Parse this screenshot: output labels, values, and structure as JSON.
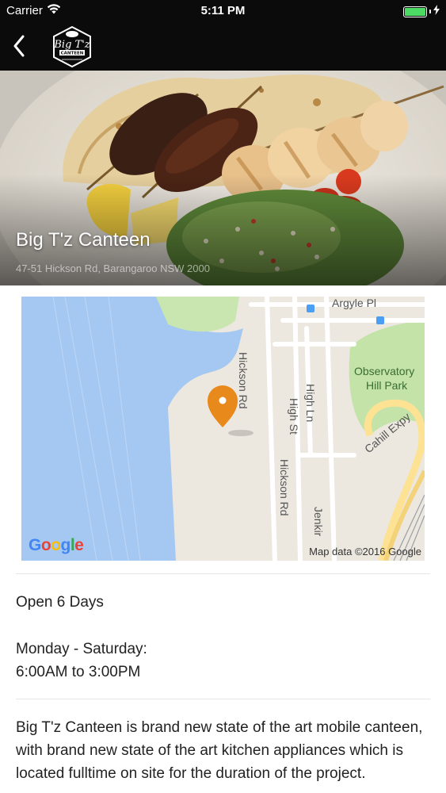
{
  "status_bar": {
    "carrier": "Carrier",
    "time": "5:11 PM",
    "battery_level": 1.0
  },
  "nav": {
    "back_icon": "chevron-left-icon",
    "logo_text": "Big T'z",
    "logo_subtext": "CANTEEN"
  },
  "venue": {
    "name": "Big T'z Canteen",
    "address": "47-51 Hickson Rd, Barangaroo NSW 2000"
  },
  "map": {
    "labels": {
      "argyle": "Argyle Pl",
      "hickson_top": "Hickson Rd",
      "high_ln": "High Ln",
      "high_st": "High St",
      "observatory": "Observatory",
      "hill_park": "Hill Park",
      "cahill": "Cahill Expy",
      "hickson_bottom": "Hickson Rd",
      "jenkins": "Jenkir"
    },
    "google": "Google",
    "credit": "Map data ©2016 Google",
    "pin_color": "#e8891c"
  },
  "details": {
    "open_days": "Open 6 Days",
    "hours_label": "Monday - Saturday:",
    "hours_value": "6:00AM to 3:00PM",
    "description": "Big T'z Canteen is brand new state of the art mobile canteen, with brand new state of the art kitchen appliances which is located fulltime on site for the duration of the project."
  }
}
